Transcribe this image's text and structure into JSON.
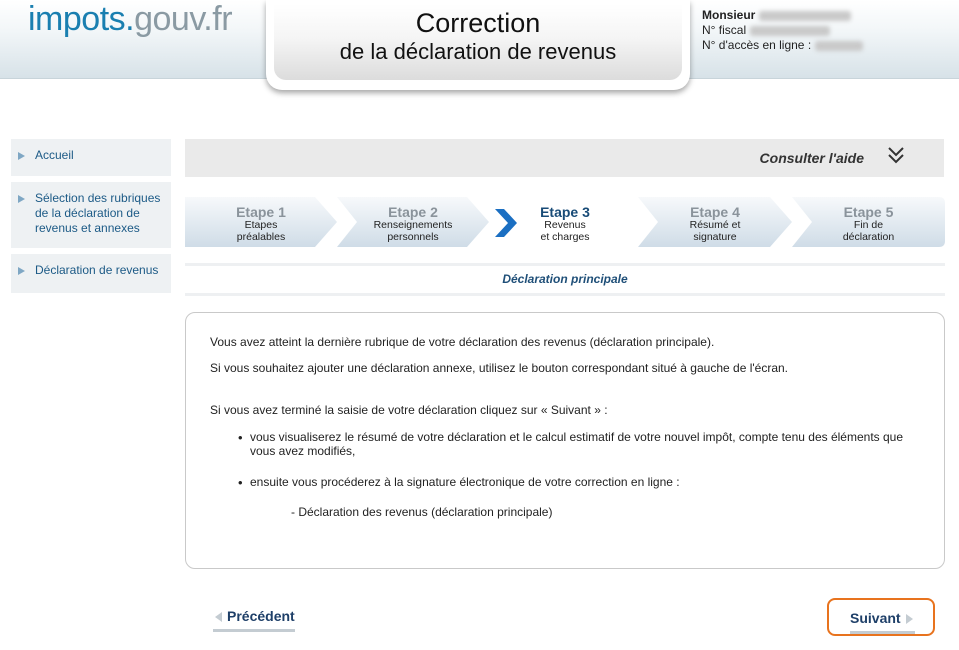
{
  "header": {
    "logo_part1": "impots.",
    "logo_part2": "gouv.fr",
    "title_line1": "Correction",
    "title_line2": "de la déclaration de revenus",
    "user_label": "Monsieur",
    "fiscal_label": "N° fiscal",
    "access_label": "N° d'accès en ligne :"
  },
  "sidebar": {
    "items": [
      {
        "label": "Accueil"
      },
      {
        "label": "Sélection des rubriques de la déclaration de revenus et annexes"
      },
      {
        "label": "Déclaration de revenus"
      }
    ]
  },
  "help": {
    "label": "Consulter l'aide"
  },
  "steps": [
    {
      "num": "Etape 1",
      "sub1": "Etapes",
      "sub2": "préalables",
      "active": false
    },
    {
      "num": "Etape 2",
      "sub1": "Renseignements",
      "sub2": "personnels",
      "active": false
    },
    {
      "num": "Etape 3",
      "sub1": "Revenus",
      "sub2": "et charges",
      "active": true
    },
    {
      "num": "Etape 4",
      "sub1": "Résumé et",
      "sub2": "signature",
      "active": false
    },
    {
      "num": "Etape 5",
      "sub1": "Fin de",
      "sub2": "déclaration",
      "active": false
    }
  ],
  "section": {
    "title": "Déclaration principale"
  },
  "content": {
    "p1": "Vous avez atteint la dernière rubrique de votre déclaration des revenus (déclaration principale).",
    "p2": "Si vous souhaitez ajouter une déclaration annexe, utilisez le bouton correspondant situé à gauche de l'écran.",
    "p3": "Si vous avez terminé la saisie de votre déclaration cliquez sur « Suivant » :",
    "bullet1": "vous visualiserez le résumé de votre déclaration et le calcul estimatif de votre nouvel impôt, compte tenu des éléments que vous avez modifiés,",
    "bullet2": "ensuite vous procéderez à la signature électronique de votre correction en ligne :",
    "sub_item": "- Déclaration des revenus (déclaration principale)"
  },
  "nav": {
    "prev_label": "Précédent",
    "next_label": "Suivant"
  },
  "colors": {
    "accent": "#1a7fb0",
    "nav_text": "#1e3f68",
    "highlight": "#e8731e",
    "step_fill": "#dde6ee"
  }
}
